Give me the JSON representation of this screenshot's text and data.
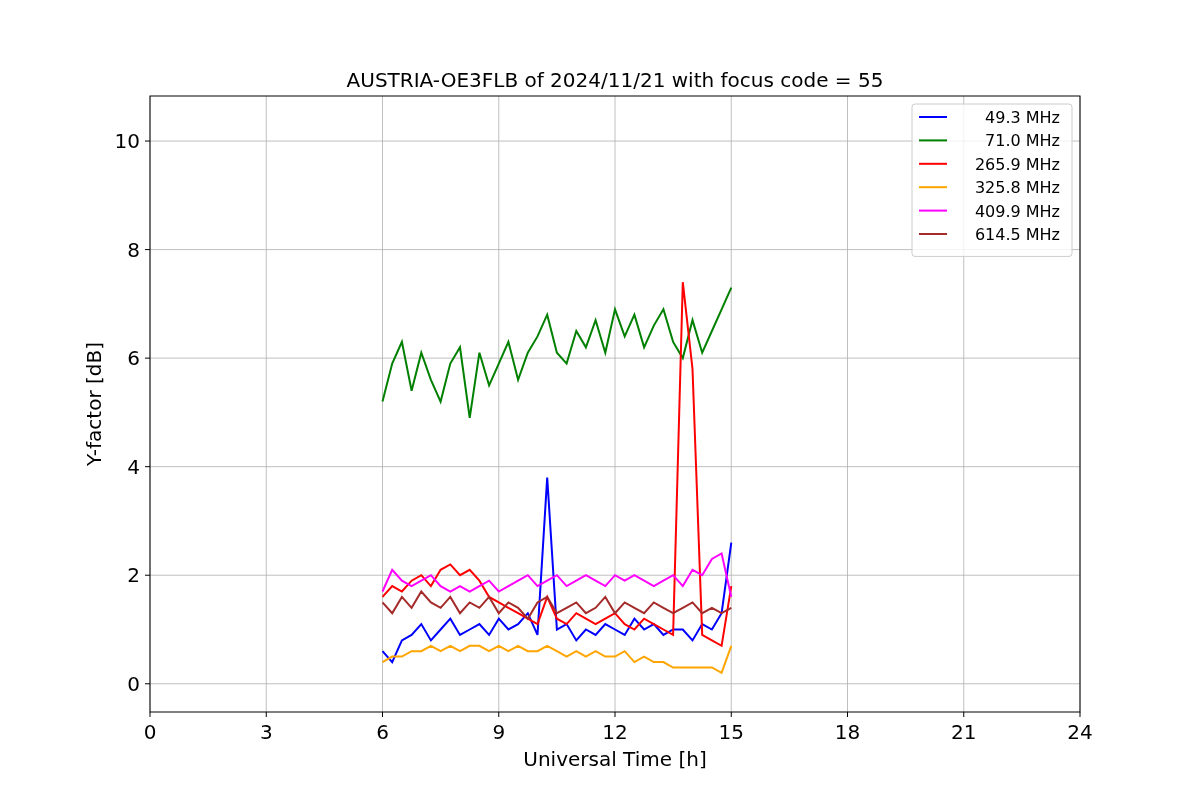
{
  "figure": {
    "chart_data": {
      "type": "line",
      "grid": true,
      "legend": true,
      "title": "AUSTRIA-OE3FLB of 2024/11/21 with focus code = 55",
      "xlabel": "Universal Time [h]",
      "ylabel": "Y-factor [dB]",
      "xlim": [
        0,
        24
      ],
      "ylim": [
        -0.52,
        10.83
      ],
      "xticks": [
        0,
        3,
        6,
        9,
        12,
        15,
        18,
        21,
        24
      ],
      "yticks": [
        0,
        2,
        4,
        6,
        8,
        10
      ],
      "x": [
        6,
        6.25,
        6.5,
        6.75,
        7,
        7.25,
        7.5,
        7.75,
        8,
        8.25,
        8.5,
        8.75,
        9,
        9.25,
        9.5,
        9.75,
        10,
        10.25,
        10.5,
        10.75,
        11,
        11.25,
        11.5,
        11.75,
        12,
        12.25,
        12.5,
        12.75,
        13,
        13.25,
        13.5,
        13.75,
        14,
        14.25,
        14.5,
        14.75,
        15
      ],
      "series": [
        {
          "name": "49.3 MHz",
          "color": "#0000ff",
          "values": [
            0.6,
            0.4,
            0.8,
            0.9,
            1.1,
            0.8,
            1.0,
            1.2,
            0.9,
            1.0,
            1.1,
            0.9,
            1.2,
            1.0,
            1.1,
            1.3,
            0.9,
            3.8,
            1.0,
            1.1,
            0.8,
            1.0,
            0.9,
            1.1,
            1.0,
            0.9,
            1.2,
            1.0,
            1.1,
            0.9,
            1.0,
            1.0,
            0.8,
            1.1,
            1.0,
            1.3,
            2.6
          ]
        },
        {
          "name": "71.0 MHz",
          "color": "#008000",
          "values": [
            5.2,
            5.9,
            6.3,
            5.4,
            6.1,
            5.6,
            5.2,
            5.9,
            6.2,
            4.9,
            6.1,
            5.5,
            5.9,
            6.3,
            5.6,
            6.1,
            6.4,
            6.8,
            6.1,
            5.9,
            6.5,
            6.2,
            6.7,
            6.1,
            6.9,
            6.4,
            6.8,
            6.2,
            6.6,
            6.9,
            6.3,
            6.0,
            6.7,
            6.1,
            6.5,
            6.9,
            7.3
          ]
        },
        {
          "name": "265.9 MHz",
          "color": "#ff0000",
          "values": [
            1.6,
            1.8,
            1.7,
            1.9,
            2.0,
            1.8,
            2.1,
            2.2,
            2.0,
            2.1,
            1.9,
            1.6,
            1.5,
            1.4,
            1.3,
            1.2,
            1.1,
            1.6,
            1.2,
            1.1,
            1.3,
            1.2,
            1.1,
            1.2,
            1.3,
            1.1,
            1.0,
            1.2,
            1.1,
            1.0,
            0.9,
            7.4,
            5.8,
            0.9,
            0.8,
            0.7,
            1.8
          ]
        },
        {
          "name": "325.8 MHz",
          "color": "#ffa500",
          "values": [
            0.4,
            0.5,
            0.5,
            0.6,
            0.6,
            0.7,
            0.6,
            0.7,
            0.6,
            0.7,
            0.7,
            0.6,
            0.7,
            0.6,
            0.7,
            0.6,
            0.6,
            0.7,
            0.6,
            0.5,
            0.6,
            0.5,
            0.6,
            0.5,
            0.5,
            0.6,
            0.4,
            0.5,
            0.4,
            0.4,
            0.3,
            0.3,
            0.3,
            0.3,
            0.3,
            0.2,
            0.7
          ]
        },
        {
          "name": "409.9 MHz",
          "color": "#ff00ff",
          "values": [
            1.7,
            2.1,
            1.9,
            1.8,
            1.9,
            2.0,
            1.8,
            1.7,
            1.8,
            1.7,
            1.8,
            1.9,
            1.7,
            1.8,
            1.9,
            2.0,
            1.8,
            1.9,
            2.0,
            1.8,
            1.9,
            2.0,
            1.9,
            1.8,
            2.0,
            1.9,
            2.0,
            1.9,
            1.8,
            1.9,
            2.0,
            1.8,
            2.1,
            2.0,
            2.3,
            2.4,
            1.6
          ]
        },
        {
          "name": "614.5 MHz",
          "color": "#a52a2a",
          "values": [
            1.5,
            1.3,
            1.6,
            1.4,
            1.7,
            1.5,
            1.4,
            1.6,
            1.3,
            1.5,
            1.4,
            1.6,
            1.3,
            1.5,
            1.4,
            1.2,
            1.5,
            1.6,
            1.3,
            1.4,
            1.5,
            1.3,
            1.4,
            1.6,
            1.3,
            1.5,
            1.4,
            1.3,
            1.5,
            1.4,
            1.3,
            1.4,
            1.5,
            1.3,
            1.4,
            1.3,
            1.4
          ]
        }
      ]
    }
  }
}
